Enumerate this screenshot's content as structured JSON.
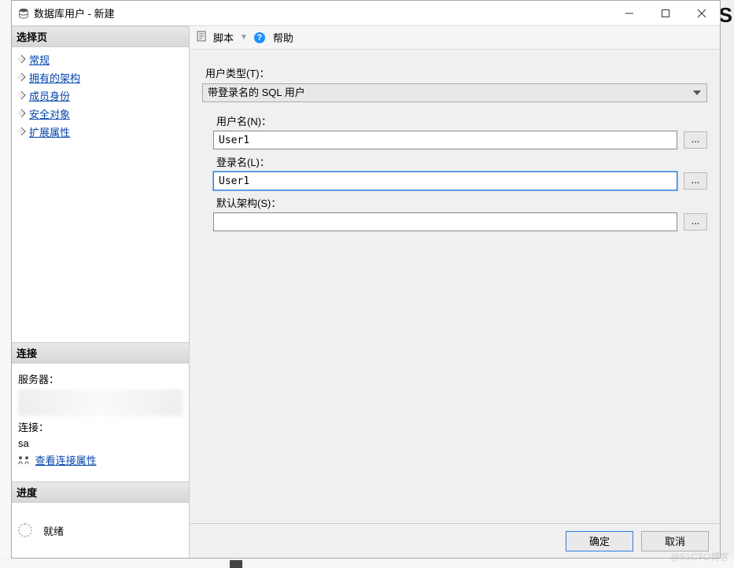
{
  "window": {
    "title": "数据库用户 - 新建"
  },
  "sidebar": {
    "select_header": "选择页",
    "items": [
      "常规",
      "拥有的架构",
      "成员身份",
      "安全对象",
      "扩展属性"
    ],
    "connection_header": "连接",
    "server_label": "服务器：",
    "connection_label": "连接：",
    "connection_value": "sa",
    "view_props_label": "查看连接属性",
    "progress_header": "进度",
    "progress_status": "就绪"
  },
  "toolbar": {
    "script_label": "脚本",
    "help_label": "帮助"
  },
  "form": {
    "user_type_label": "用户类型(T)：",
    "user_type_value": "带登录名的 SQL 用户",
    "username_label": "用户名(N)：",
    "username_value": "User1",
    "login_label": "登录名(L)：",
    "login_value": "User1",
    "schema_label": "默认架构(S)：",
    "schema_value": "",
    "browse": "..."
  },
  "buttons": {
    "ok": "确定",
    "cancel": "取消"
  },
  "extras": {
    "s": "S",
    "watermark": "@51CTO博客"
  }
}
